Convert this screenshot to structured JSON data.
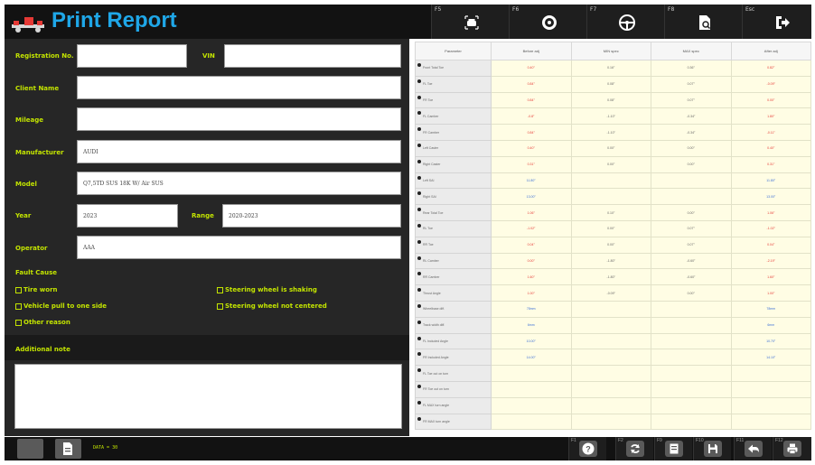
{
  "header": {
    "title": "Print Report",
    "keys": [
      {
        "label": "F5",
        "icon": "car-front-icon"
      },
      {
        "label": "F6",
        "icon": "wheel-icon"
      },
      {
        "label": "F7",
        "icon": "steering-wheel-icon"
      },
      {
        "label": "F8",
        "icon": "report-search-icon"
      },
      {
        "label": "Esc",
        "icon": "exit-icon"
      }
    ]
  },
  "form": {
    "registration_label": "Registration No.",
    "registration_value": "",
    "vin_label": "VIN",
    "vin_value": "",
    "client_label": "Client Name",
    "client_value": "",
    "mileage_label": "Mileage",
    "mileage_value": "",
    "manufacturer_label": "Manufacturer",
    "manufacturer_value": "AUDI",
    "model_label": "Model",
    "model_value": "Q7,5TD SUS 18K W/ Air SUS",
    "year_label": "Year",
    "year_value": "2023",
    "range_label": "Range",
    "range_value": "2020-2023",
    "operator_label": "Operator",
    "operator_value": "AAA",
    "fault_cause_label": "Fault Cause",
    "fault_options": [
      "Tire worn",
      "Steering wheel is shaking",
      "Vehicle pull to one side",
      "Steering wheel not centered",
      "Other reason"
    ],
    "note_label": "Additional note",
    "note_value": ""
  },
  "table": {
    "headers": [
      "Parameter",
      "Before adj",
      "MIN spec",
      "MAX spec",
      "After adj"
    ],
    "rows": [
      {
        "name": "Front Total Toe",
        "before": "0.40°",
        "min": "0.16°",
        "max": "0.36°",
        "after": "0.82°",
        "bc": "red",
        "ac": "red"
      },
      {
        "name": "FL Toe",
        "before": "0.84°",
        "min": "0.08°",
        "max": "0.07°",
        "after": "-0.09°",
        "bc": "red",
        "ac": "red"
      },
      {
        "name": "FR Toe",
        "before": "0.84°",
        "min": "0.08°",
        "max": "0.07°",
        "after": "0.00°",
        "bc": "red",
        "ac": "red"
      },
      {
        "name": "FL Camber",
        "before": "-0.8°",
        "min": "-1.10°",
        "max": "-0.34°",
        "after": "1.80°",
        "bc": "red",
        "ac": "red"
      },
      {
        "name": "FR Camber",
        "before": "0.84°",
        "min": "-1.10°",
        "max": "-0.34°",
        "after": "-0.11°",
        "bc": "red",
        "ac": "red"
      },
      {
        "name": "Left Caster",
        "before": "0.40°",
        "min": "0.00°",
        "max": "0.00°",
        "after": "0.40°",
        "bc": "red",
        "ac": "red"
      },
      {
        "name": "Right Caster",
        "before": "0.31°",
        "min": "0.00°",
        "max": "0.00°",
        "after": "0.31°",
        "bc": "red",
        "ac": "red"
      },
      {
        "name": "Left SAI",
        "before": "11.80°",
        "min": "",
        "max": "",
        "after": "11.80°",
        "bc": "blue",
        "ac": "blue"
      },
      {
        "name": "Right SAI",
        "before": "13.00°",
        "min": "",
        "max": "",
        "after": "13.00°",
        "bc": "blue",
        "ac": "blue"
      },
      {
        "name": "Rear Total Toe",
        "before": "1.06°",
        "min": "0.10°",
        "max": "0.00°",
        "after": "1.06°",
        "bc": "red",
        "ac": "red"
      },
      {
        "name": "RL Toe",
        "before": "-1.02°",
        "min": "0.00°",
        "max": "0.07°",
        "after": "-1.02°",
        "bc": "red",
        "ac": "red"
      },
      {
        "name": "RR Toe",
        "before": "0.04°",
        "min": "0.00°",
        "max": "0.07°",
        "after": "0.04°",
        "bc": "red",
        "ac": "red"
      },
      {
        "name": "RL Camber",
        "before": "0.00°",
        "min": "-1.80°",
        "max": "-0.60°",
        "after": "-2.19°",
        "bc": "red",
        "ac": "red"
      },
      {
        "name": "RR Camber",
        "before": "1.60°",
        "min": "-1.80°",
        "max": "-0.60°",
        "after": "1.60°",
        "bc": "red",
        "ac": "red"
      },
      {
        "name": "Thrust Angle",
        "before": "1.00°",
        "min": "-0.09°",
        "max": "0.00°",
        "after": "1.00°",
        "bc": "red",
        "ac": "red"
      },
      {
        "name": "Wheelbase diff.",
        "before": "78mm",
        "min": "",
        "max": "",
        "after": "78mm",
        "bc": "blue",
        "ac": "blue"
      },
      {
        "name": "Track width diff.",
        "before": "6mm",
        "min": "",
        "max": "",
        "after": "6mm",
        "bc": "blue",
        "ac": "blue"
      },
      {
        "name": "FL Included Angle",
        "before": "10.00°",
        "min": "",
        "max": "",
        "after": "10.70°",
        "bc": "blue",
        "ac": "blue"
      },
      {
        "name": "FR Included Angle",
        "before": "14.00°",
        "min": "",
        "max": "",
        "after": "14.10°",
        "bc": "blue",
        "ac": "blue"
      },
      {
        "name": "FL Toe out on turn",
        "before": "",
        "min": "",
        "max": "",
        "after": "",
        "bc": "",
        "ac": ""
      },
      {
        "name": "FR Toe out on turn",
        "before": "",
        "min": "",
        "max": "",
        "after": "",
        "bc": "",
        "ac": ""
      },
      {
        "name": "FL MAX turn angle",
        "before": "",
        "min": "",
        "max": "",
        "after": "",
        "bc": "",
        "ac": ""
      },
      {
        "name": "FR MAX turn angle",
        "before": "",
        "min": "",
        "max": "",
        "after": "",
        "bc": "",
        "ac": ""
      }
    ]
  },
  "footer": {
    "data_count": "DATA = 30",
    "keys": [
      {
        "label": "F1",
        "icon": "help-icon"
      },
      {
        "label": "F2",
        "icon": "refresh-icon"
      },
      {
        "label": "F9",
        "icon": "document-icon"
      },
      {
        "label": "F10",
        "icon": "save-icon"
      },
      {
        "label": "F11",
        "icon": "back-icon"
      },
      {
        "label": "F12",
        "icon": "print-icon"
      }
    ]
  }
}
